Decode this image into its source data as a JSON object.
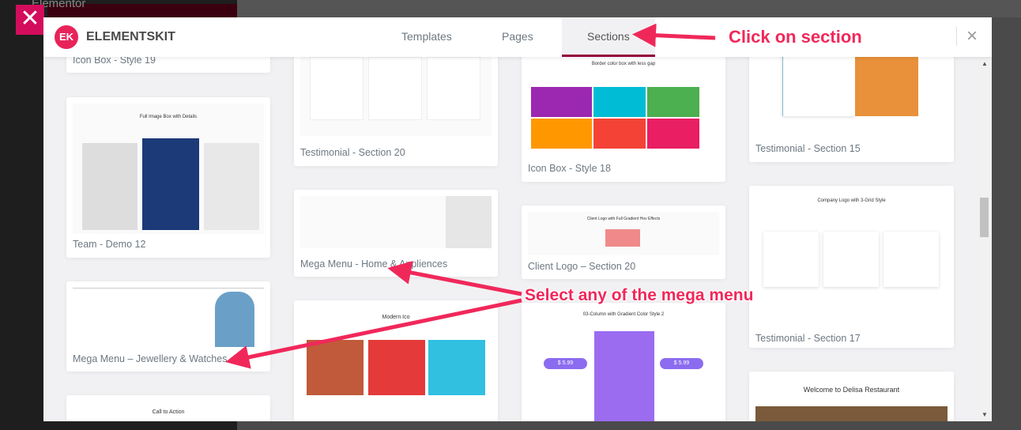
{
  "background": {
    "app_title": "Elementor"
  },
  "overlay_close_icon": "close-icon",
  "header": {
    "brand": "ELEMENTSKIT",
    "logo_text": "EK",
    "tabs": [
      {
        "label": "Templates"
      },
      {
        "label": "Pages"
      },
      {
        "label": "Sections",
        "active": true
      }
    ],
    "close": "×"
  },
  "cards": [
    {
      "label": "Icon Box - Style 19"
    },
    {
      "label": "Team - Demo 12"
    },
    {
      "label": "Mega Menu – Jewellery & Watches"
    },
    {
      "label": "Testimonial - Section 20"
    },
    {
      "label": "Mega Menu - Home & Appliences"
    },
    {
      "label": "Icon Box - Style 18"
    },
    {
      "label": "Client Logo – Section 20"
    },
    {
      "label": "Testimonial - Section 15"
    },
    {
      "label": "Testimonial - Section 17"
    }
  ],
  "thumb_titles": {
    "team": "Full Image Box with Details",
    "iconbox": "Border color box with less gap",
    "clientlogo": "Client Logo with Full Gradient Hov Effects",
    "company": "Company Logo with 3-Grid Style",
    "pricing": "03-Column with Gradient Color Style 2",
    "price": "$ 5.99",
    "restaurant": "Welcome to Delisa Restaurant",
    "cta": "Call to Action",
    "modern": "Modern Ico"
  },
  "annotations": {
    "click": "Click on section",
    "select": "Select any of the mega menu"
  },
  "colors": {
    "accent": "#e8235a",
    "active_tab": "#93003c",
    "annotation": "#f0285a"
  }
}
